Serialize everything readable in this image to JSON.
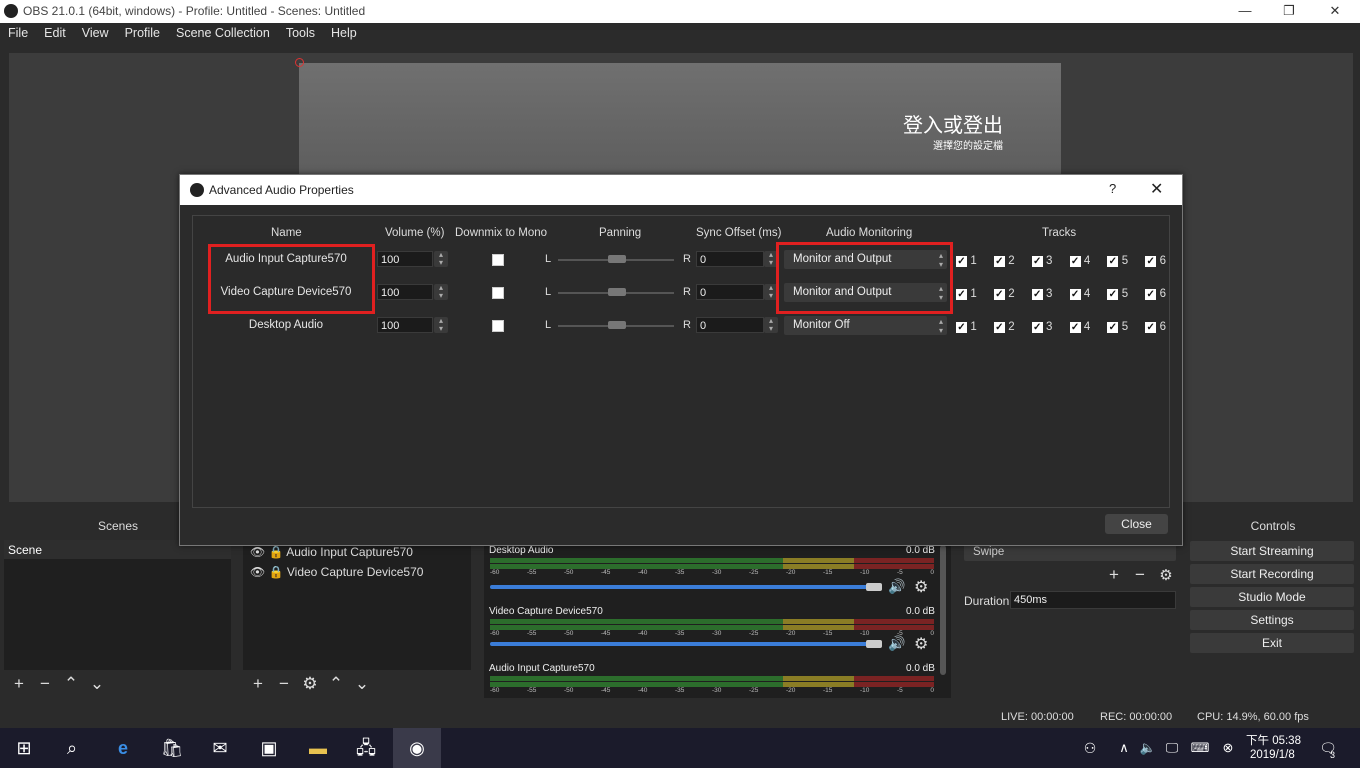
{
  "window": {
    "title": "OBS 21.0.1 (64bit, windows) - Profile: Untitled - Scenes: Untitled"
  },
  "menu": [
    "File",
    "Edit",
    "View",
    "Profile",
    "Scene Collection",
    "Tools",
    "Help"
  ],
  "preview": {
    "big_text": "登入或登出",
    "small_text": "選擇您的設定檔"
  },
  "dialog": {
    "title": "Advanced Audio Properties",
    "help": "?",
    "headers": {
      "name": "Name",
      "volume": "Volume (%)",
      "downmix": "Downmix to Mono",
      "panning": "Panning",
      "sync": "Sync Offset (ms)",
      "monitoring": "Audio Monitoring",
      "tracks": "Tracks"
    },
    "rows": [
      {
        "name": "Audio Input Capture570",
        "volume": "100",
        "downmix": false,
        "pan_left": "L",
        "pan_right": "R",
        "sync": "0",
        "monitoring": "Monitor and Output",
        "tracks": [
          "1",
          "2",
          "3",
          "4",
          "5",
          "6"
        ]
      },
      {
        "name": "Video Capture Device570",
        "volume": "100",
        "downmix": false,
        "pan_left": "L",
        "pan_right": "R",
        "sync": "0",
        "monitoring": "Monitor and Output",
        "tracks": [
          "1",
          "2",
          "3",
          "4",
          "5",
          "6"
        ]
      },
      {
        "name": "Desktop Audio",
        "volume": "100",
        "downmix": false,
        "pan_left": "L",
        "pan_right": "R",
        "sync": "0",
        "monitoring": "Monitor Off",
        "tracks": [
          "1",
          "2",
          "3",
          "4",
          "5",
          "6"
        ]
      }
    ],
    "close_label": "Close",
    "highlight_color": "#e02020"
  },
  "scenes": {
    "title": "Scenes",
    "items": [
      "Scene"
    ]
  },
  "sources": {
    "items": [
      "Audio Input Capture570",
      "Video Capture Device570"
    ]
  },
  "mixer": {
    "channels": [
      {
        "name": "Desktop Audio",
        "db": "0.0 dB"
      },
      {
        "name": "Video Capture Device570",
        "db": "0.0 dB"
      },
      {
        "name": "Audio Input Capture570",
        "db": "0.0 dB"
      }
    ],
    "ticks": [
      "-60",
      "-55",
      "-50",
      "-45",
      "-40",
      "-35",
      "-30",
      "-25",
      "-20",
      "-15",
      "-10",
      "-5",
      "0"
    ]
  },
  "transitions": {
    "type": "Swipe",
    "duration_label": "Duration",
    "duration_value": "450ms"
  },
  "controls": {
    "title": "Controls",
    "buttons": [
      "Start Streaming",
      "Start Recording",
      "Studio Mode",
      "Settings",
      "Exit"
    ]
  },
  "status": {
    "live": "LIVE: 00:00:00",
    "rec": "REC: 00:00:00",
    "cpu": "CPU: 14.9%, 60.00 fps"
  },
  "taskbar": {
    "time": "下午 05:38",
    "date": "2019/1/8",
    "notif_count": "3"
  }
}
